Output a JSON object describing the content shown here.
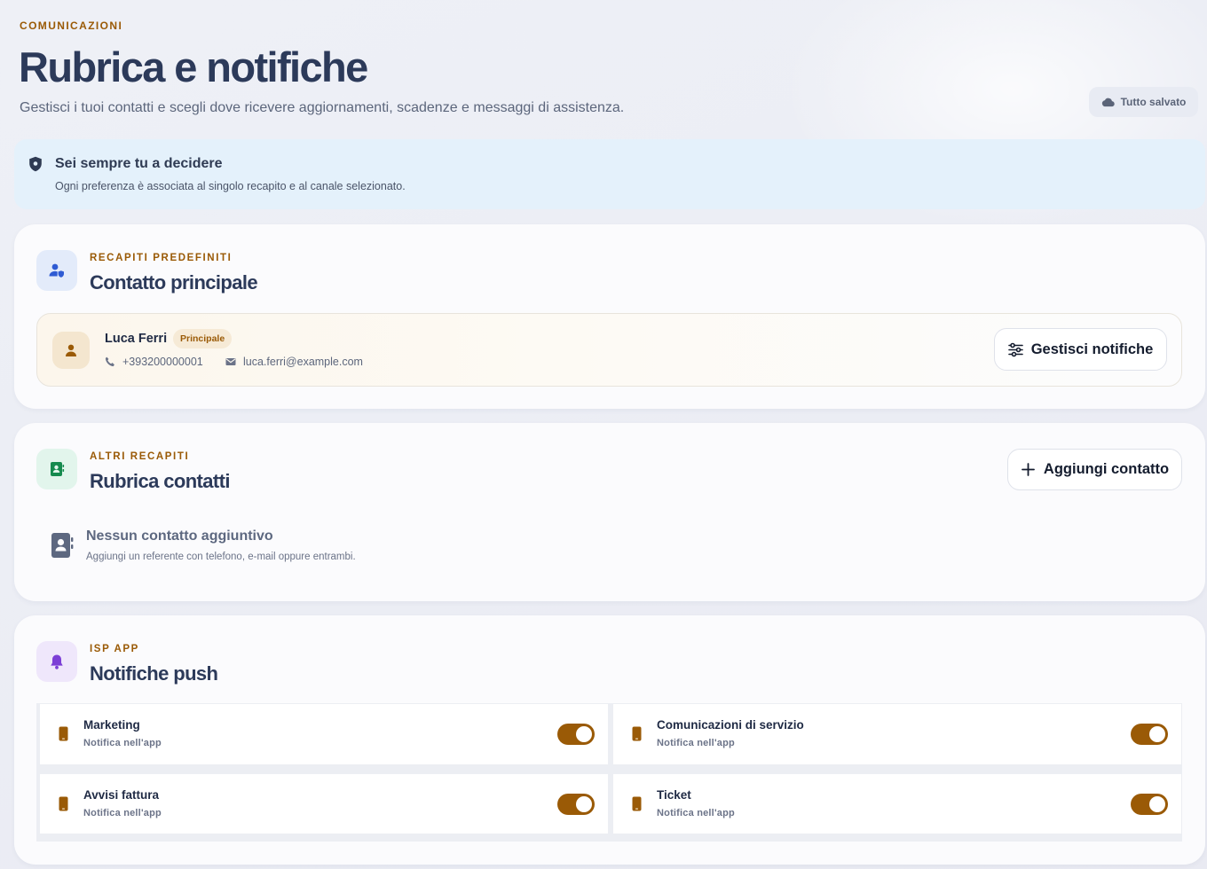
{
  "header": {
    "eyebrow": "COMUNICAZIONI",
    "title": "Rubrica e notifiche",
    "subtitle": "Gestisci i tuoi contatti e scegli dove ricevere aggiornamenti, scadenze e messaggi di assistenza.",
    "save_status": "Tutto salvato"
  },
  "info_banner": {
    "icon": "shield-icon",
    "title": "Sei sempre tu a decidere",
    "text": "Ogni preferenza è associata al singolo recapito e al canale selezionato."
  },
  "primary_section": {
    "icon": "user-shield-icon",
    "eyebrow": "RECAPITI PREDEFINITI",
    "title": "Contatto principale",
    "contact": {
      "name": "Luca Ferri",
      "badge": "Principale",
      "phone": "+393200000001",
      "email": "luca.ferri@example.com"
    },
    "manage_button": "Gestisci notifiche"
  },
  "contacts_section": {
    "icon": "contact-book-icon",
    "eyebrow": "ALTRI RECAPITI",
    "title": "Rubrica contatti",
    "add_button": "Aggiungi contatto",
    "empty_title": "Nessun contatto aggiuntivo",
    "empty_text": "Aggiungi un referente con telefono, e-mail oppure entrambi."
  },
  "push_section": {
    "icon": "bell-icon",
    "eyebrow": "ISP APP",
    "title": "Notifiche push",
    "items": [
      {
        "title": "Marketing",
        "subtitle": "Notifica nell'app",
        "enabled": true
      },
      {
        "title": "Comunicazioni di servizio",
        "subtitle": "Notifica nell'app",
        "enabled": true
      },
      {
        "title": "Avvisi fattura",
        "subtitle": "Notifica nell'app",
        "enabled": true
      },
      {
        "title": "Ticket",
        "subtitle": "Notifica nell'app",
        "enabled": true
      }
    ]
  },
  "colors": {
    "accent": "#9a5a06",
    "title": "#2c3a5a",
    "info_bg": "#e4f1fb",
    "bell_bg": "#efe7fb",
    "contacts_bg": "#e2f5ec",
    "primary_icon_bg": "#e3ebfa"
  }
}
